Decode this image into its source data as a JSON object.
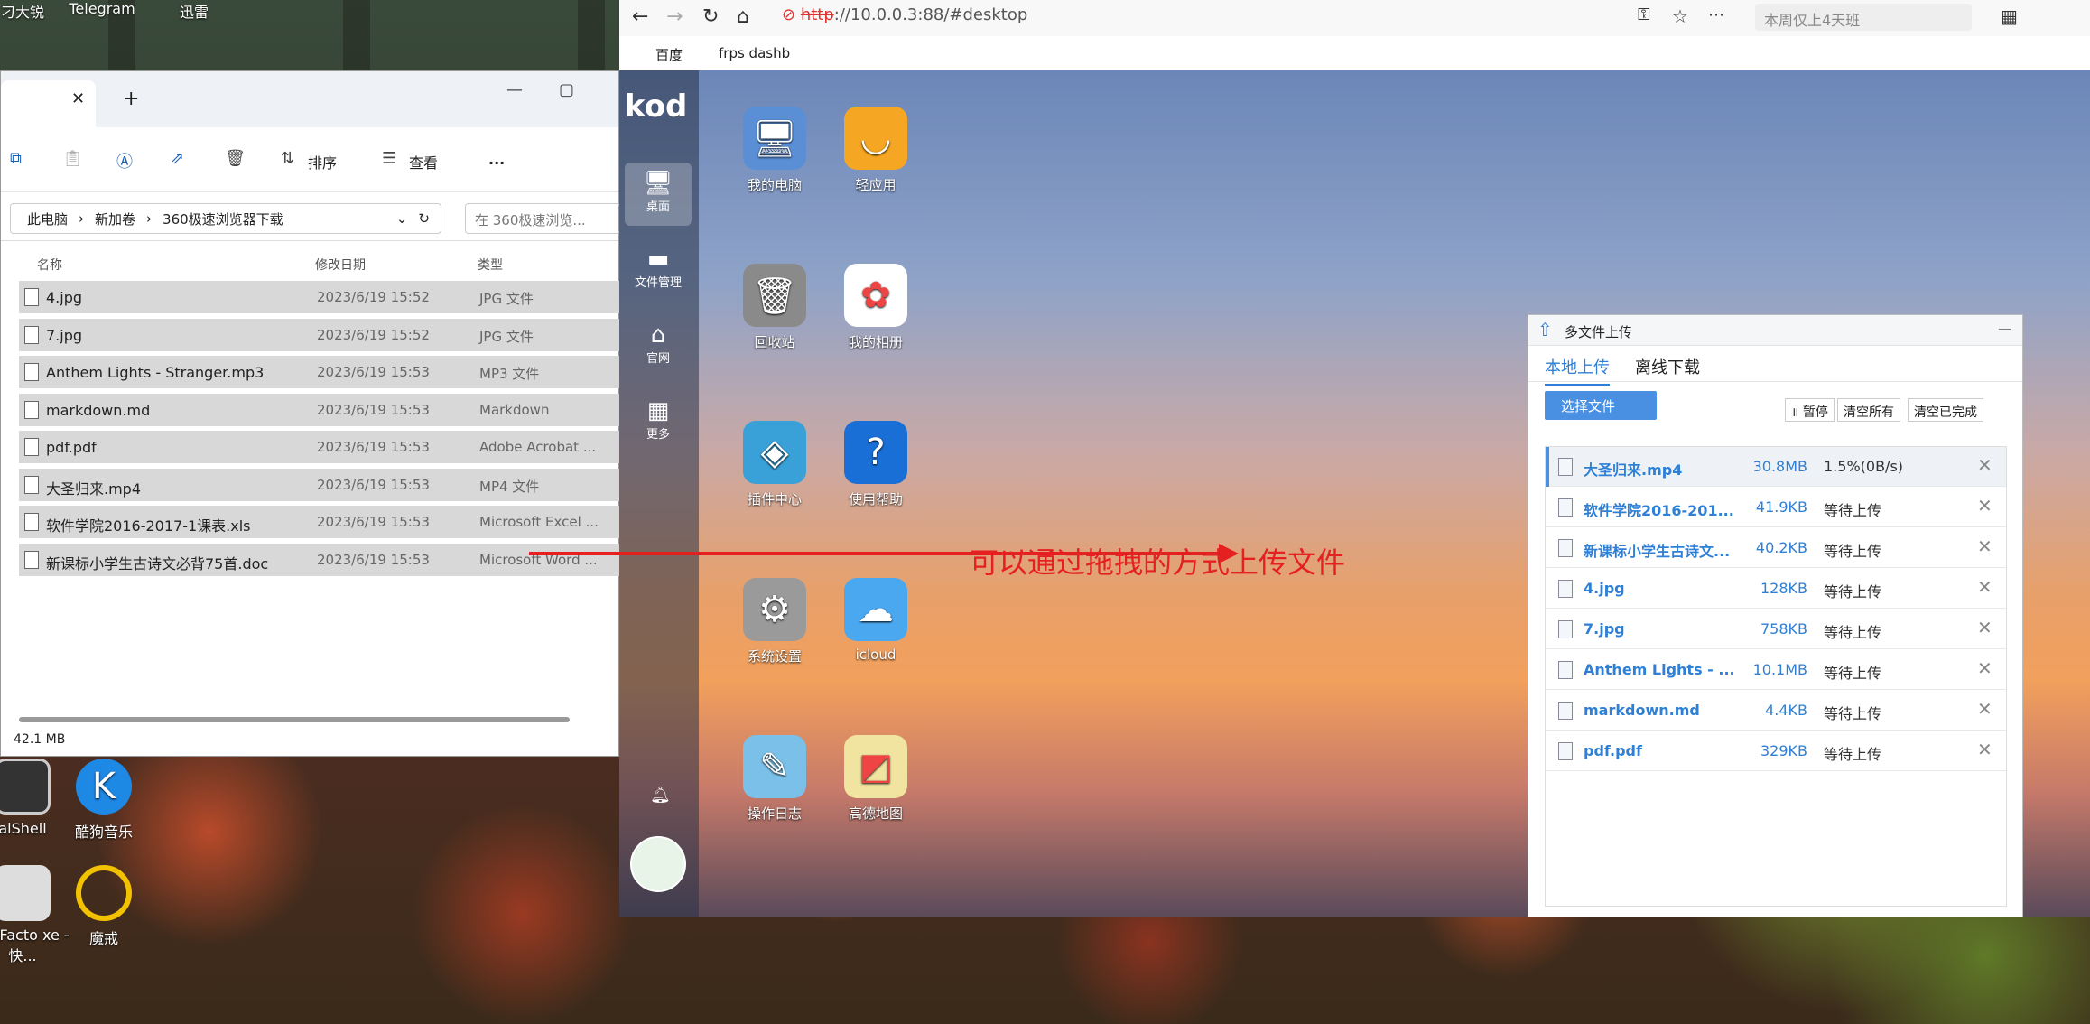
{
  "desktop": {
    "icons": [
      {
        "label": "刁大锐",
        "x": 0,
        "y": 0
      },
      {
        "label": "Telegram"
      },
      {
        "label": "迅雷"
      },
      {
        "label": "alShell"
      },
      {
        "label": "酷狗音乐"
      },
      {
        "label": "natFacto xe - 快..."
      },
      {
        "label": "魔戒"
      }
    ]
  },
  "explorer": {
    "tab_close": "✕",
    "tab_new": "+",
    "toolbar": {
      "sort": "排序",
      "view": "查看",
      "more": "..."
    },
    "breadcrumb": [
      "此电脑",
      "新加卷",
      "360极速浏览器下载"
    ],
    "search_placeholder": "在 360极速浏览...",
    "columns": {
      "name": "名称",
      "date": "修改日期",
      "type": "类型"
    },
    "files": [
      {
        "name": "4.jpg",
        "date": "2023/6/19 15:52",
        "type": "JPG 文件"
      },
      {
        "name": "7.jpg",
        "date": "2023/6/19 15:52",
        "type": "JPG 文件"
      },
      {
        "name": "Anthem Lights - Stranger.mp3",
        "date": "2023/6/19 15:53",
        "type": "MP3 文件"
      },
      {
        "name": "markdown.md",
        "date": "2023/6/19 15:53",
        "type": "Markdown"
      },
      {
        "name": "pdf.pdf",
        "date": "2023/6/19 15:53",
        "type": "Adobe Acrobat ..."
      },
      {
        "name": "大圣归来.mp4",
        "date": "2023/6/19 15:53",
        "type": "MP4 文件"
      },
      {
        "name": "软件学院2016-2017-1课表.xls",
        "date": "2023/6/19 15:53",
        "type": "Microsoft Excel ..."
      },
      {
        "name": "新课标小学生古诗文必背75首.doc",
        "date": "2023/6/19 15:53",
        "type": "Microsoft Word ..."
      }
    ],
    "status": "42.1 MB"
  },
  "browser": {
    "url_scheme": "http",
    "url_rest": "://10.0.0.3:88/#desktop",
    "search_text": "本周仅上4天班",
    "bookmarks": [
      "百度",
      "frps dashb"
    ]
  },
  "kod": {
    "logo": "kod",
    "side": [
      "桌面",
      "文件管理",
      "官网",
      "更多"
    ],
    "icons": [
      "我的电脑",
      "轻应用",
      "回收站",
      "我的相册",
      "插件中心",
      "使用帮助",
      "系统设置",
      "icloud",
      "操作日志",
      "高德地图"
    ],
    "note": "可以通过拖拽的方式上传文件"
  },
  "upload": {
    "title": "多文件上传",
    "tabs": [
      "本地上传",
      "离线下载"
    ],
    "select_btn": "选择文件",
    "controls": [
      "暂停",
      "清空所有",
      "清空已完成"
    ],
    "items": [
      {
        "name": "大圣归来.mp4",
        "size": "30.8MB",
        "status": "1.5%(0B/s)",
        "progress": 0.015
      },
      {
        "name": "软件学院2016-201...",
        "size": "41.9KB",
        "status": "等待上传"
      },
      {
        "name": "新课标小学生古诗文...",
        "size": "40.2KB",
        "status": "等待上传"
      },
      {
        "name": "4.jpg",
        "size": "128KB",
        "status": "等待上传"
      },
      {
        "name": "7.jpg",
        "size": "758KB",
        "status": "等待上传"
      },
      {
        "name": "Anthem Lights - ...",
        "size": "10.1MB",
        "status": "等待上传"
      },
      {
        "name": "markdown.md",
        "size": "4.4KB",
        "status": "等待上传"
      },
      {
        "name": "pdf.pdf",
        "size": "329KB",
        "status": "等待上传"
      }
    ]
  }
}
